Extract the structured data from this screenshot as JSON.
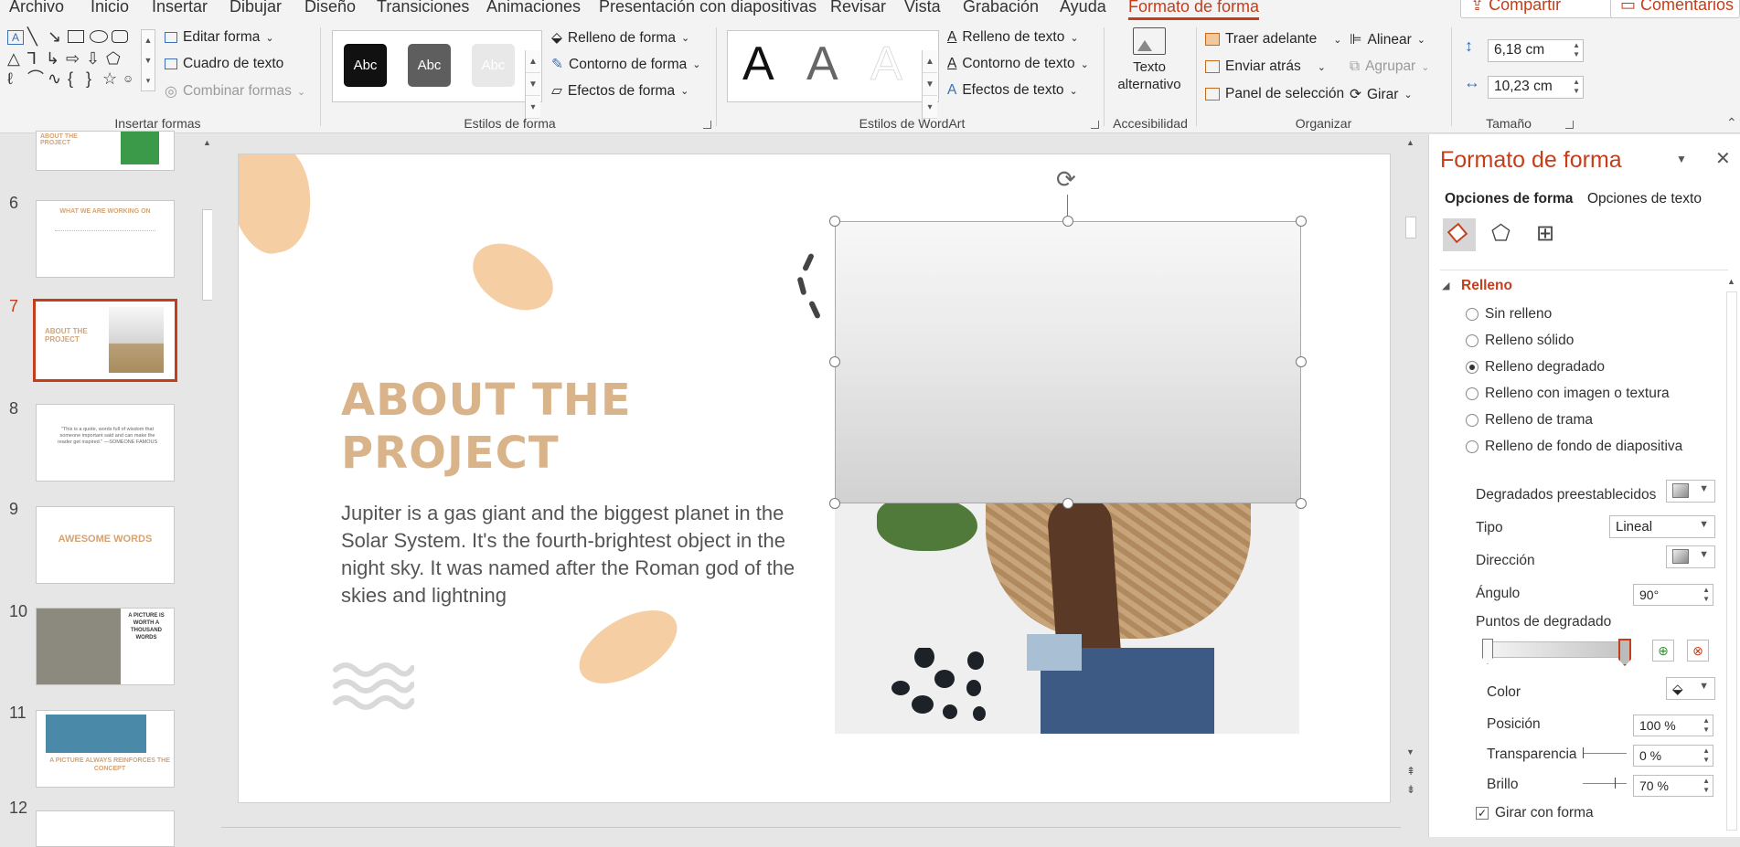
{
  "menu": {
    "tabs": [
      "Archivo",
      "Inicio",
      "Insertar",
      "Dibujar",
      "Diseño",
      "Transiciones",
      "Animaciones",
      "Presentación con diapositivas",
      "Revisar",
      "Vista",
      "Grabación",
      "Ayuda",
      "Formato de forma"
    ],
    "active_tab": "Formato de forma",
    "share": "Compartir",
    "comments": "Comentarios"
  },
  "ribbon": {
    "insert_shapes": {
      "label": "Insertar formas",
      "edit_shape": "Editar forma",
      "text_box": "Cuadro de texto",
      "merge_shapes": "Combinar formas"
    },
    "shape_styles": {
      "label": "Estilos de forma",
      "sample": "Abc",
      "shape_fill": "Relleno de forma",
      "shape_outline": "Contorno de forma",
      "shape_effects": "Efectos de forma"
    },
    "wordart": {
      "label": "Estilos de WordArt",
      "sample": "A",
      "text_fill": "Relleno de texto",
      "text_outline": "Contorno de texto",
      "text_effects": "Efectos de texto"
    },
    "accessibility": {
      "label": "Accesibilidad",
      "alt_text_line1": "Texto",
      "alt_text_line2": "alternativo"
    },
    "arrange": {
      "label": "Organizar",
      "bring_forward": "Traer adelante",
      "send_backward": "Enviar atrás",
      "selection_pane": "Panel de selección",
      "align": "Alinear",
      "group": "Agrupar",
      "rotate": "Girar"
    },
    "size": {
      "label": "Tamaño",
      "height": "6,18 cm",
      "width": "10,23 cm"
    }
  },
  "thumbnails": [
    {
      "num": "",
      "title": "ABOUT THE PROJECT"
    },
    {
      "num": "6",
      "title": "WHAT WE ARE WORKING ON"
    },
    {
      "num": "7",
      "title": "ABOUT THE PROJECT"
    },
    {
      "num": "8",
      "title": "\"This is a quote, words full of wisdom that someone important said and can make the reader get inspired.\" —SOMEONE FAMOUS"
    },
    {
      "num": "9",
      "title": "AWESOME WORDS"
    },
    {
      "num": "10",
      "title": "A PICTURE IS WORTH A THOUSAND WORDS"
    },
    {
      "num": "11",
      "title": "A PICTURE ALWAYS REINFORCES THE CONCEPT"
    },
    {
      "num": "12",
      "title": ""
    }
  ],
  "active_slide": "7",
  "slide": {
    "title_line1": "ABOUT THE",
    "title_line2": "PROJECT",
    "body": "Jupiter is a gas giant and the biggest planet in the Solar System. It's the fourth-brightest object in the night sky. It was named after the Roman god of the skies and lightning"
  },
  "format_pane": {
    "title": "Formato de forma",
    "tab_shape": "Opciones de forma",
    "tab_text": "Opciones de texto",
    "section": "Relleno",
    "fill_options": [
      "Sin relleno",
      "Relleno sólido",
      "Relleno degradado",
      "Relleno con imagen o textura",
      "Relleno de trama",
      "Relleno de fondo de diapositiva"
    ],
    "selected_fill": "Relleno degradado",
    "preset_gradients": "Degradados preestablecidos",
    "type_label": "Tipo",
    "type_value": "Lineal",
    "direction_label": "Dirección",
    "angle_label": "Ángulo",
    "angle_value": "90°",
    "stops_label": "Puntos de degradado",
    "color_label": "Color",
    "position_label": "Posición",
    "position_value": "100 %",
    "transparency_label": "Transparencia",
    "transparency_value": "0 %",
    "brightness_label": "Brillo",
    "brightness_value": "70 %",
    "rotate_with_shape": "Girar con forma",
    "rotate_with_shape_checked": true
  },
  "colors": {
    "accent": "#c43e1c",
    "title_color": "#d9b48a",
    "blob": "#f5cfa3"
  }
}
